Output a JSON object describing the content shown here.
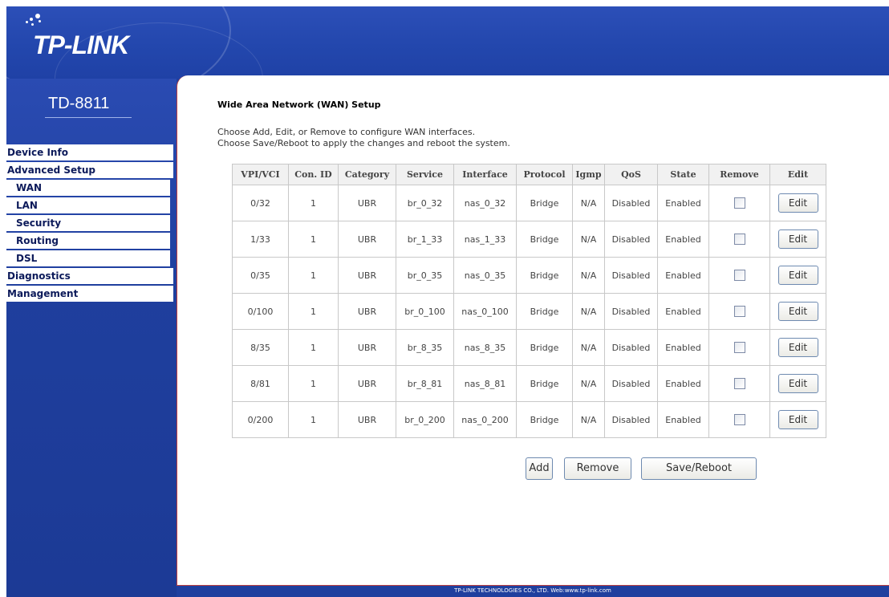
{
  "header": {
    "logo_text": "TP-LINK"
  },
  "sidebar": {
    "model": "TD-8811",
    "items": [
      {
        "label": "Device Info",
        "sub": false,
        "name": "device-info"
      },
      {
        "label": "Advanced Setup",
        "sub": false,
        "name": "advanced-setup"
      },
      {
        "label": "WAN",
        "sub": true,
        "name": "wan"
      },
      {
        "label": "LAN",
        "sub": true,
        "name": "lan"
      },
      {
        "label": "Security",
        "sub": true,
        "name": "security"
      },
      {
        "label": "Routing",
        "sub": true,
        "name": "routing"
      },
      {
        "label": "DSL",
        "sub": true,
        "name": "dsl"
      },
      {
        "label": "Diagnostics",
        "sub": false,
        "name": "diagnostics"
      },
      {
        "label": "Management",
        "sub": false,
        "name": "management"
      }
    ]
  },
  "main": {
    "title": "Wide Area Network (WAN) Setup",
    "desc1": "Choose Add, Edit, or Remove to configure WAN interfaces.",
    "desc2": "Choose Save/Reboot to apply the changes and reboot the system.",
    "columns": [
      "VPI/VCI",
      "Con. ID",
      "Category",
      "Service",
      "Interface",
      "Protocol",
      "Igmp",
      "QoS",
      "State",
      "Remove",
      "Edit"
    ],
    "rows": [
      [
        "0/32",
        "1",
        "UBR",
        "br_0_32",
        "nas_0_32",
        "Bridge",
        "N/A",
        "Disabled",
        "Enabled"
      ],
      [
        "1/33",
        "1",
        "UBR",
        "br_1_33",
        "nas_1_33",
        "Bridge",
        "N/A",
        "Disabled",
        "Enabled"
      ],
      [
        "0/35",
        "1",
        "UBR",
        "br_0_35",
        "nas_0_35",
        "Bridge",
        "N/A",
        "Disabled",
        "Enabled"
      ],
      [
        "0/100",
        "1",
        "UBR",
        "br_0_100",
        "nas_0_100",
        "Bridge",
        "N/A",
        "Disabled",
        "Enabled"
      ],
      [
        "8/35",
        "1",
        "UBR",
        "br_8_35",
        "nas_8_35",
        "Bridge",
        "N/A",
        "Disabled",
        "Enabled"
      ],
      [
        "8/81",
        "1",
        "UBR",
        "br_8_81",
        "nas_8_81",
        "Bridge",
        "N/A",
        "Disabled",
        "Enabled"
      ],
      [
        "0/200",
        "1",
        "UBR",
        "br_0_200",
        "nas_0_200",
        "Bridge",
        "N/A",
        "Disabled",
        "Enabled"
      ]
    ],
    "edit_label": "Edit",
    "buttons": {
      "add": "Add",
      "remove": "Remove",
      "save": "Save/Reboot"
    }
  },
  "footer": {
    "text": "TP-LINK TECHNOLOGIES CO., LTD. Web:www.tp-link.com"
  }
}
